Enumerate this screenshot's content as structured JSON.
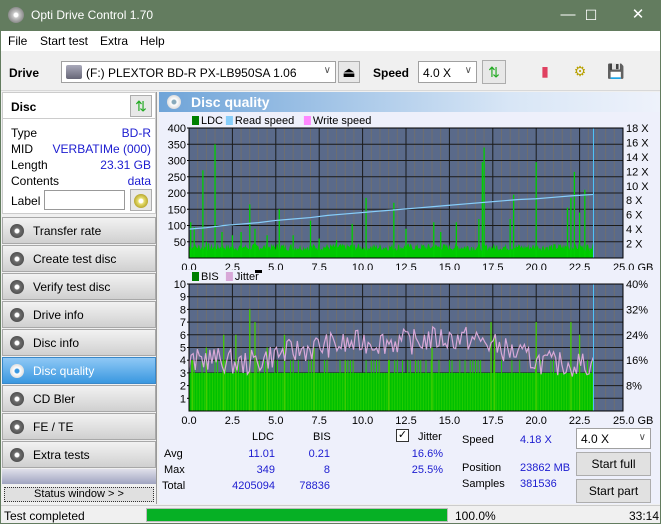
{
  "window": {
    "title": "Opti Drive Control 1.70",
    "minimize": "—",
    "maximize": "☐",
    "close": "✕"
  },
  "menu": [
    "File",
    "Start test",
    "Extra",
    "Help"
  ],
  "toolbar": {
    "drive_label": "Drive",
    "drive_value": "(F:)  PLEXTOR BD-R  PX-LB950SA 1.06",
    "speed_label": "Speed",
    "speed_value": "4.0 X"
  },
  "disc": {
    "header": "Disc",
    "fields": [
      {
        "key": "Type",
        "value": "BD-R"
      },
      {
        "key": "MID",
        "value": "VERBATIMe (000)"
      },
      {
        "key": "Length",
        "value": "23.31 GB"
      },
      {
        "key": "Contents",
        "value": "data"
      }
    ],
    "label_key": "Label",
    "label_value": ""
  },
  "nav": [
    {
      "label": "Transfer rate",
      "active": false
    },
    {
      "label": "Create test disc",
      "active": false
    },
    {
      "label": "Verify test disc",
      "active": false
    },
    {
      "label": "Drive info",
      "active": false
    },
    {
      "label": "Disc info",
      "active": false
    },
    {
      "label": "Disc quality",
      "active": true
    },
    {
      "label": "CD Bler",
      "active": false
    },
    {
      "label": "FE / TE",
      "active": false
    },
    {
      "label": "Extra tests",
      "active": false
    }
  ],
  "status_window_button": "Status window > >",
  "panel_title": "Disc quality",
  "chart_data": [
    {
      "type": "bar",
      "title": "LDC chart",
      "legend": [
        {
          "name": "LDC",
          "color": "#008000"
        },
        {
          "name": "Read speed",
          "color": "#87cefa"
        },
        {
          "name": "Write speed",
          "color": "#ff88ff"
        }
      ],
      "x_ticks": [
        "0.0",
        "2.5",
        "5.0",
        "7.5",
        "10.0",
        "12.5",
        "15.0",
        "17.5",
        "20.0",
        "22.5",
        "25.0 GB"
      ],
      "y_left_ticks": [
        "400",
        "350",
        "300",
        "250",
        "200",
        "150",
        "100",
        "50"
      ],
      "y_right_ticks": [
        "18 X",
        "16 X",
        "14 X",
        "12 X",
        "10 X",
        "8 X",
        "6 X",
        "4 X",
        "2 X"
      ],
      "xlim": [
        0,
        25
      ],
      "ylim": [
        0,
        400
      ],
      "y2lim": [
        0,
        18
      ],
      "end_position_gb": 23.3,
      "ldc_baseline": 40,
      "ldc_spikes": [
        [
          0.1,
          110
        ],
        [
          0.3,
          95
        ],
        [
          0.8,
          270
        ],
        [
          1.0,
          50
        ],
        [
          1.5,
          350
        ],
        [
          1.9,
          80
        ],
        [
          2.5,
          70
        ],
        [
          3.0,
          80
        ],
        [
          3.5,
          165
        ],
        [
          3.8,
          90
        ],
        [
          4.5,
          70
        ],
        [
          5.2,
          150
        ],
        [
          6.0,
          70
        ],
        [
          7.0,
          115
        ],
        [
          7.5,
          60
        ],
        [
          8.5,
          55
        ],
        [
          9.4,
          105
        ],
        [
          10.2,
          185
        ],
        [
          11.8,
          170
        ],
        [
          12.5,
          90
        ],
        [
          14.1,
          110
        ],
        [
          14.5,
          80
        ],
        [
          15.4,
          110
        ],
        [
          16.7,
          120
        ],
        [
          16.9,
          295
        ],
        [
          17.0,
          340
        ],
        [
          18.5,
          120
        ],
        [
          18.7,
          195
        ],
        [
          20.0,
          295
        ],
        [
          21.8,
          155
        ],
        [
          22.0,
          185
        ],
        [
          22.2,
          265
        ],
        [
          22.5,
          140
        ],
        [
          22.8,
          210
        ],
        [
          23.1,
          30
        ]
      ],
      "read_speed": [
        [
          0,
          4.0
        ],
        [
          1.0,
          4.2
        ],
        [
          2.0,
          4.5
        ],
        [
          3.0,
          4.7
        ],
        [
          4.0,
          4.9
        ],
        [
          5.0,
          5.2
        ],
        [
          6.0,
          5.4
        ],
        [
          7.0,
          5.6
        ],
        [
          8.0,
          5.9
        ],
        [
          9.0,
          6.1
        ],
        [
          10.0,
          6.3
        ],
        [
          11.0,
          6.5
        ],
        [
          12.0,
          6.7
        ],
        [
          13.0,
          6.9
        ],
        [
          14.0,
          7.1
        ],
        [
          15.0,
          7.3
        ],
        [
          16.0,
          7.5
        ],
        [
          17.0,
          7.7
        ],
        [
          18.0,
          7.9
        ],
        [
          19.0,
          8.1
        ],
        [
          20.0,
          8.2
        ],
        [
          21.0,
          8.4
        ],
        [
          22.0,
          8.6
        ],
        [
          23.3,
          8.8
        ]
      ]
    },
    {
      "type": "bar",
      "title": "BIS chart",
      "legend": [
        {
          "name": "BIS",
          "color": "#008000"
        },
        {
          "name": "Jitter",
          "color": "#d8a8d8"
        }
      ],
      "x_ticks": [
        "0.0",
        "2.5",
        "5.0",
        "7.5",
        "10.0",
        "12.5",
        "15.0",
        "17.5",
        "20.0",
        "22.5",
        "25.0 GB"
      ],
      "y_left_ticks": [
        "10",
        "9",
        "8",
        "7",
        "6",
        "5",
        "4",
        "3",
        "2",
        "1"
      ],
      "y_right_ticks": [
        "40%",
        "32%",
        "24%",
        "16%",
        "8%"
      ],
      "xlim": [
        0,
        25
      ],
      "ylim": [
        0,
        10
      ],
      "y2lim": [
        0,
        40
      ],
      "end_position_gb": 23.3,
      "bis_baseline": 3,
      "bis_spikes": [
        [
          0.2,
          4
        ],
        [
          1.0,
          5
        ],
        [
          2.0,
          6
        ],
        [
          2.7,
          6
        ],
        [
          3.5,
          8
        ],
        [
          3.8,
          7
        ],
        [
          4.5,
          5
        ],
        [
          5.5,
          6
        ],
        [
          7.2,
          5
        ],
        [
          9.0,
          4
        ],
        [
          11.5,
          4
        ],
        [
          14.0,
          5
        ],
        [
          17.4,
          7
        ],
        [
          17.6,
          6
        ],
        [
          20.0,
          7
        ],
        [
          22.0,
          7
        ],
        [
          22.5,
          6
        ]
      ],
      "jitter_pct": [
        [
          0,
          14
        ],
        [
          1,
          16
        ],
        [
          2,
          15
        ],
        [
          3,
          14
        ],
        [
          4,
          15
        ],
        [
          5,
          17
        ],
        [
          6,
          18
        ],
        [
          7,
          19
        ],
        [
          8,
          20
        ],
        [
          9,
          20
        ],
        [
          10,
          21
        ],
        [
          11,
          21
        ],
        [
          12,
          21
        ],
        [
          13,
          21
        ],
        [
          14,
          22
        ],
        [
          15,
          22
        ],
        [
          16,
          22
        ],
        [
          17,
          21
        ],
        [
          18,
          19
        ],
        [
          19,
          17
        ],
        [
          20,
          15
        ],
        [
          21,
          14
        ],
        [
          22,
          14
        ],
        [
          23.3,
          14
        ]
      ]
    }
  ],
  "stats": {
    "headers": [
      "LDC",
      "BIS"
    ],
    "rows": [
      {
        "label": "Avg",
        "ldc": "11.01",
        "bis": "0.21",
        "jitter": "16.6%"
      },
      {
        "label": "Max",
        "ldc": "349",
        "bis": "8",
        "jitter": "25.5%"
      },
      {
        "label": "Total",
        "ldc": "4205094",
        "bis": "78836"
      }
    ],
    "jitter_label": "Jitter",
    "jitter_checked": true,
    "speed_label": "Speed",
    "speed_value": "4.18 X",
    "position_label": "Position",
    "position_value": "23862 MB",
    "samples_label": "Samples",
    "samples_value": "381536",
    "speed_select": "4.0 X",
    "start_full": "Start full",
    "start_part": "Start part"
  },
  "statusbar": {
    "text": "Test completed",
    "progress": 1.0,
    "progress_text": "100.0%",
    "time": "33:14",
    "progress_color": "#06b025"
  }
}
